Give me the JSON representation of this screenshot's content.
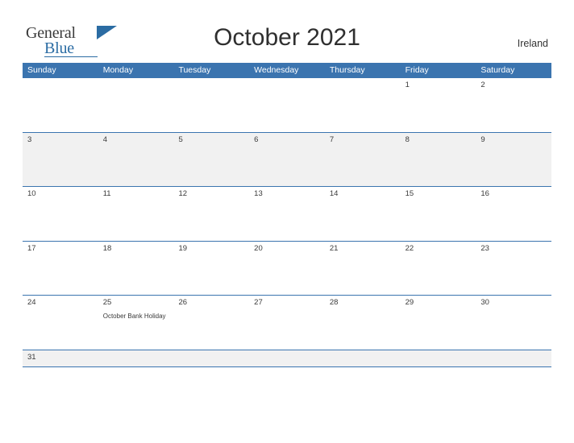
{
  "logo": {
    "word1": "General",
    "word2": "Blue",
    "flag_icon": "flag-triangle-icon"
  },
  "header": {
    "title": "October 2021",
    "country": "Ireland"
  },
  "calendar": {
    "weekdays": [
      "Sunday",
      "Monday",
      "Tuesday",
      "Wednesday",
      "Thursday",
      "Friday",
      "Saturday"
    ],
    "accent_color": "#3b74af",
    "alt_row_color": "#f1f1f1",
    "weeks": [
      {
        "shaded": false,
        "days": [
          {
            "num": "",
            "event": ""
          },
          {
            "num": "",
            "event": ""
          },
          {
            "num": "",
            "event": ""
          },
          {
            "num": "",
            "event": ""
          },
          {
            "num": "",
            "event": ""
          },
          {
            "num": "1",
            "event": ""
          },
          {
            "num": "2",
            "event": ""
          }
        ]
      },
      {
        "shaded": true,
        "days": [
          {
            "num": "3",
            "event": ""
          },
          {
            "num": "4",
            "event": ""
          },
          {
            "num": "5",
            "event": ""
          },
          {
            "num": "6",
            "event": ""
          },
          {
            "num": "7",
            "event": ""
          },
          {
            "num": "8",
            "event": ""
          },
          {
            "num": "9",
            "event": ""
          }
        ]
      },
      {
        "shaded": false,
        "days": [
          {
            "num": "10",
            "event": ""
          },
          {
            "num": "11",
            "event": ""
          },
          {
            "num": "12",
            "event": ""
          },
          {
            "num": "13",
            "event": ""
          },
          {
            "num": "14",
            "event": ""
          },
          {
            "num": "15",
            "event": ""
          },
          {
            "num": "16",
            "event": ""
          }
        ]
      },
      {
        "shaded": false,
        "days": [
          {
            "num": "17",
            "event": ""
          },
          {
            "num": "18",
            "event": ""
          },
          {
            "num": "19",
            "event": ""
          },
          {
            "num": "20",
            "event": ""
          },
          {
            "num": "21",
            "event": ""
          },
          {
            "num": "22",
            "event": ""
          },
          {
            "num": "23",
            "event": ""
          }
        ]
      },
      {
        "shaded": false,
        "days": [
          {
            "num": "24",
            "event": ""
          },
          {
            "num": "25",
            "event": "October Bank Holiday"
          },
          {
            "num": "26",
            "event": ""
          },
          {
            "num": "27",
            "event": ""
          },
          {
            "num": "28",
            "event": ""
          },
          {
            "num": "29",
            "event": ""
          },
          {
            "num": "30",
            "event": ""
          }
        ]
      },
      {
        "shaded": true,
        "days": [
          {
            "num": "31",
            "event": ""
          },
          {
            "num": "",
            "event": ""
          },
          {
            "num": "",
            "event": ""
          },
          {
            "num": "",
            "event": ""
          },
          {
            "num": "",
            "event": ""
          },
          {
            "num": "",
            "event": ""
          },
          {
            "num": "",
            "event": ""
          }
        ]
      }
    ]
  }
}
